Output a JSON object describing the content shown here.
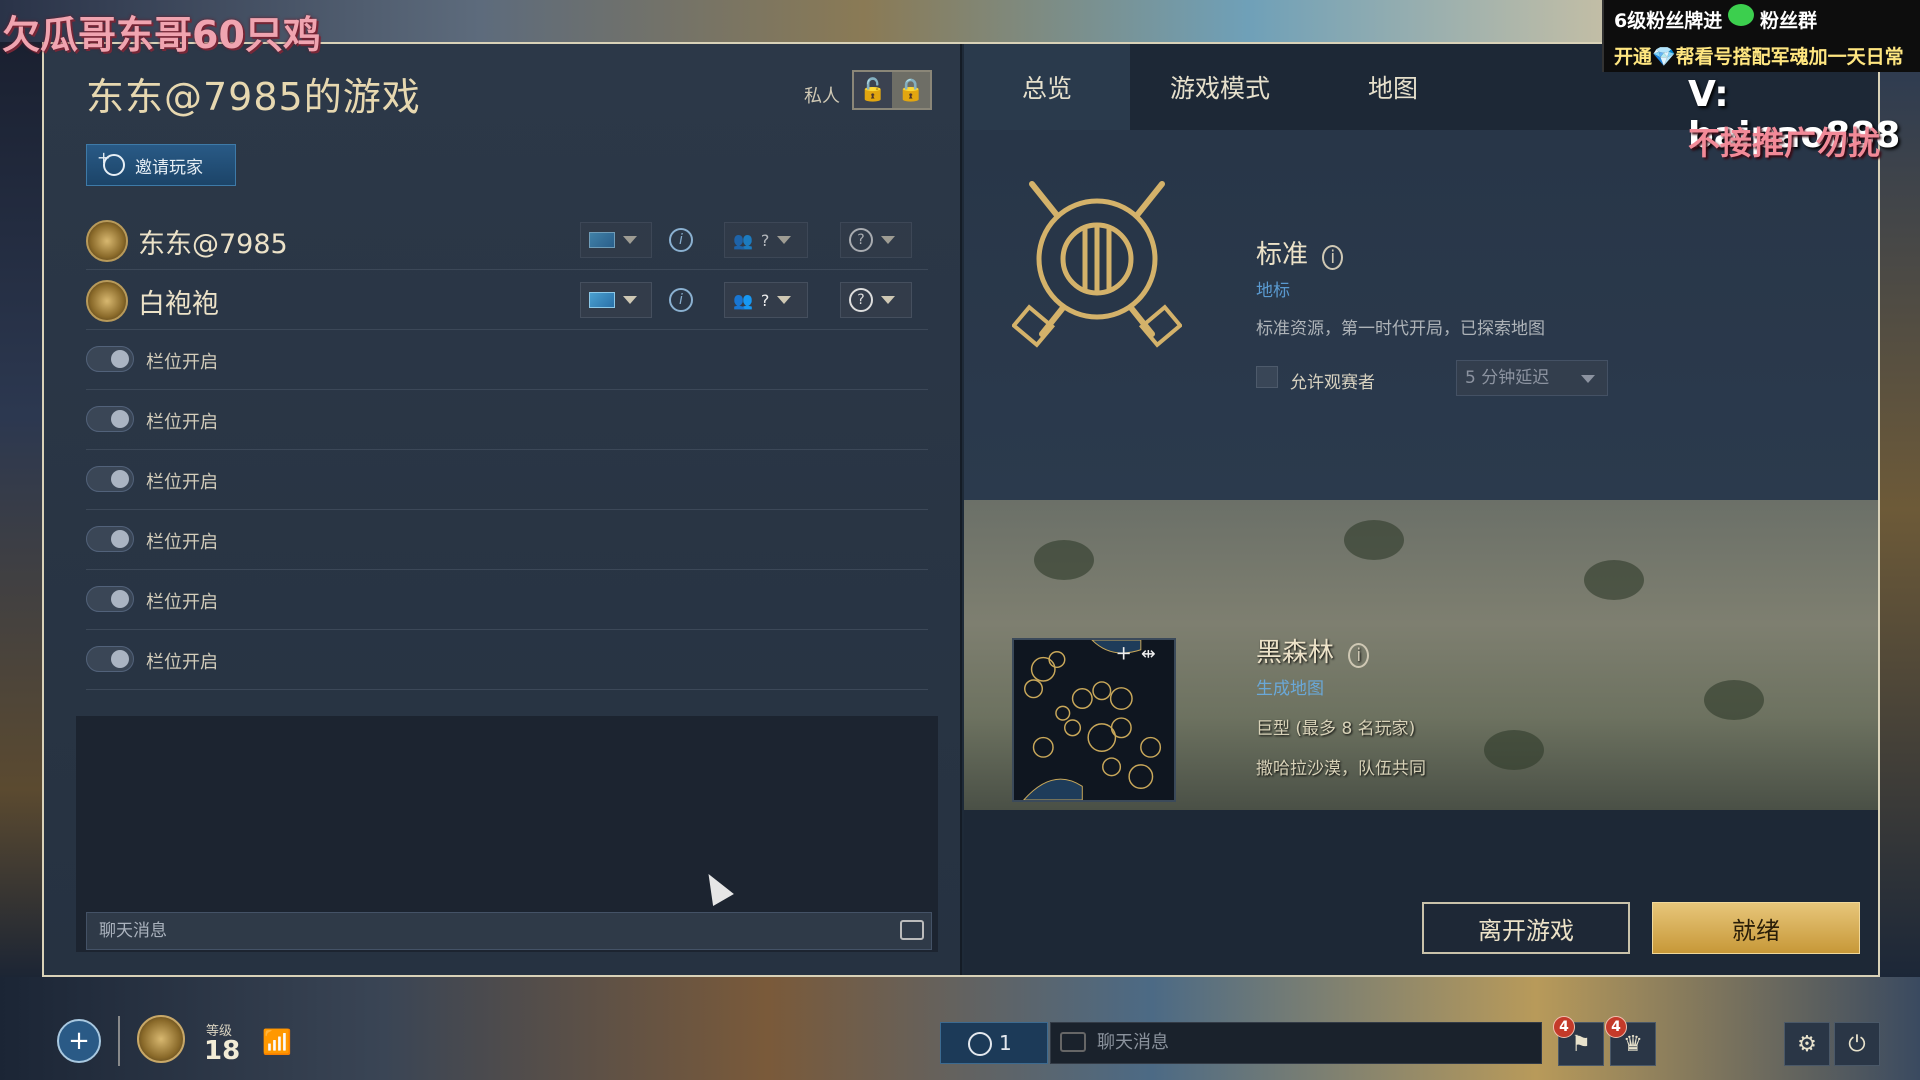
{
  "overlay": {
    "watermark": "欠瓜哥东哥60只鸡",
    "promo_line1a": "6级粉丝牌进",
    "promo_line1b": "粉丝群",
    "promo_line2": "开通💎帮看号搭配军魂加一天日常",
    "contact": "V: baipao888",
    "no_ads": "不接推广勿扰"
  },
  "lobby": {
    "title": "东东@7985的游戏",
    "private_label": "私人",
    "invite_button": "邀请玩家",
    "players": [
      {
        "name": "东东@7985",
        "team": "?",
        "civ": "?"
      },
      {
        "name": "白袍袍",
        "team": "?",
        "civ": "?"
      }
    ],
    "slots": [
      "栏位开启",
      "栏位开启",
      "栏位开启",
      "栏位开启",
      "栏位开启",
      "栏位开启"
    ],
    "chat_placeholder": "聊天消息"
  },
  "tabs": [
    "总览",
    "游戏模式",
    "地图"
  ],
  "mode": {
    "title": "标准",
    "subtitle": "地标",
    "description": "标准资源，第一时代开局，已探索地图",
    "spectator_label": "允许观赛者",
    "delay_value": "5 分钟延迟"
  },
  "map": {
    "title": "黑森林",
    "subtitle": "生成地图",
    "size": "巨型 (最多 8 名玩家)",
    "extra": "撒哈拉沙漠，队伍共同"
  },
  "actions": {
    "leave": "离开游戏",
    "ready": "就绪"
  },
  "hud": {
    "level_label": "等级",
    "level": "18",
    "friends_count": "1",
    "chat_placeholder": "聊天消息",
    "notif_badge_1": "4",
    "notif_badge_2": "4"
  },
  "colors": {
    "accent_gold": "#e7c67a",
    "link_blue": "#5a9ad0",
    "panel_dark": "#263241"
  }
}
